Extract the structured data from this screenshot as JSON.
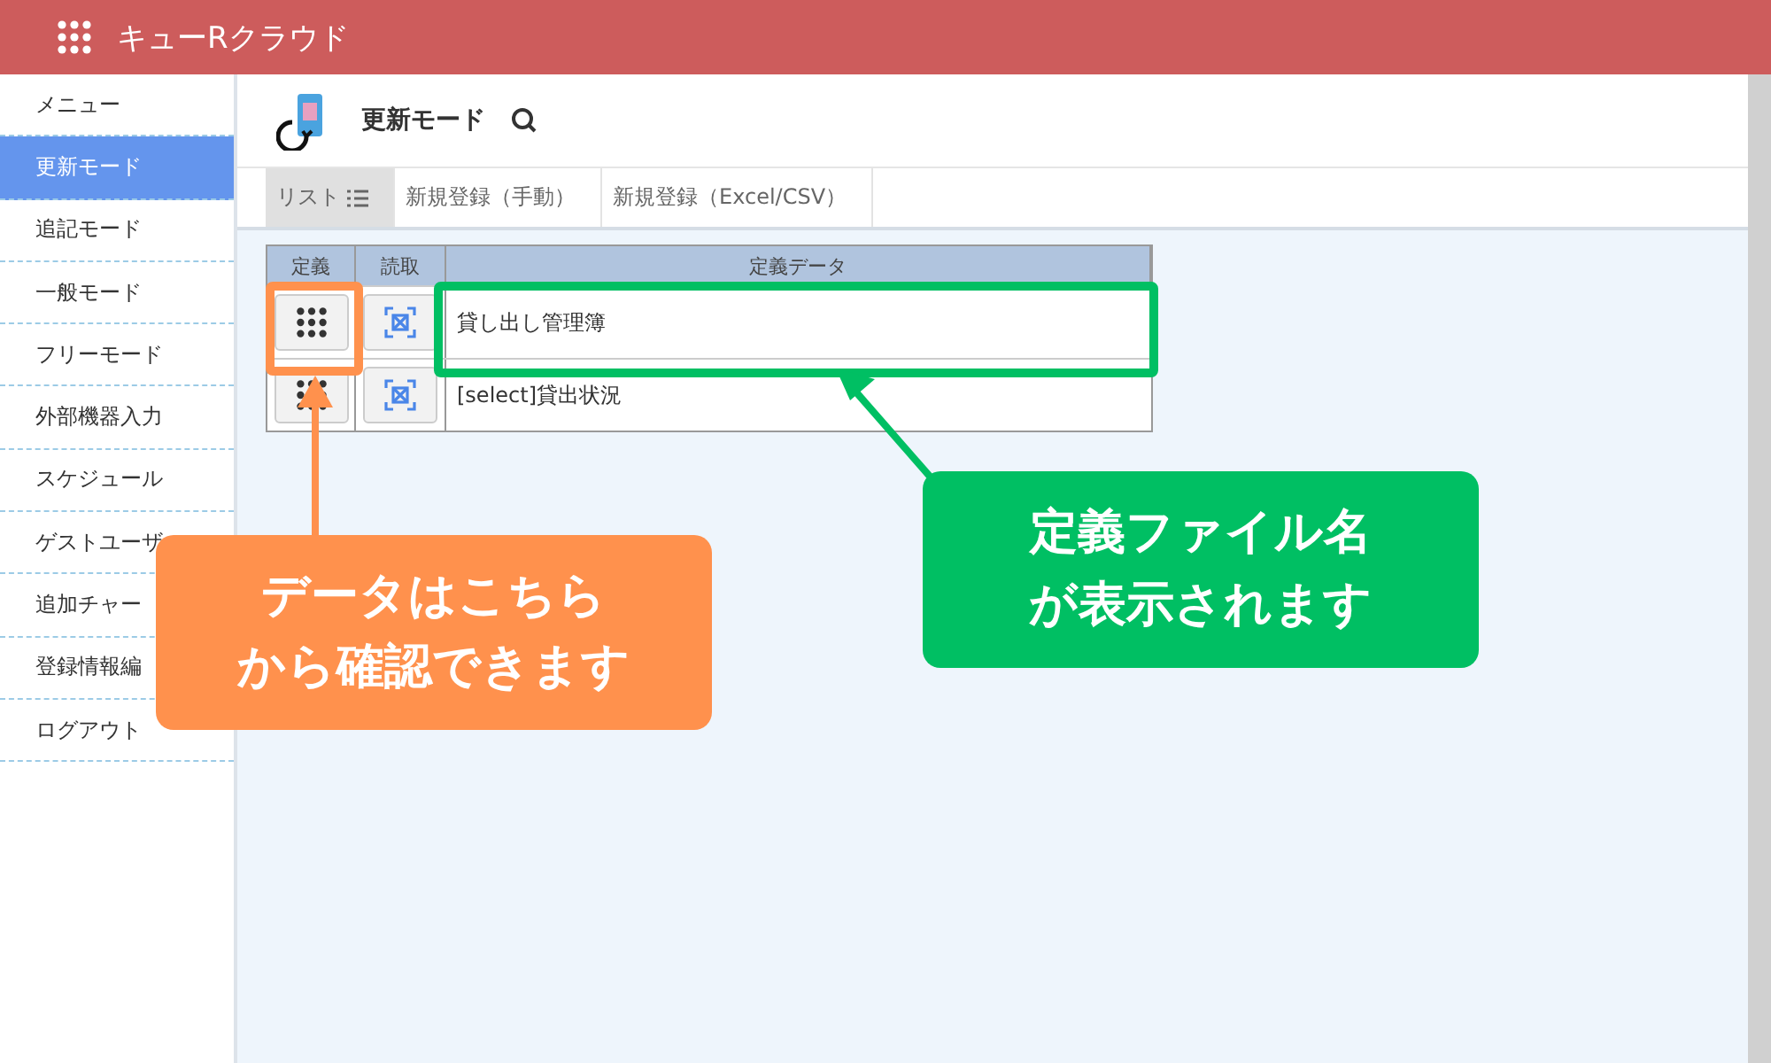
{
  "app": {
    "title": "キューRクラウド"
  },
  "sidebar": {
    "items": [
      {
        "label": "メニュー",
        "selected": false
      },
      {
        "label": "更新モード",
        "selected": true
      },
      {
        "label": "追記モード",
        "selected": false
      },
      {
        "label": "一般モード",
        "selected": false
      },
      {
        "label": "フリーモード",
        "selected": false
      },
      {
        "label": "外部機器入力",
        "selected": false
      },
      {
        "label": "スケジュール",
        "selected": false
      },
      {
        "label": "ゲストユーザ",
        "selected": false
      },
      {
        "label": "追加チャー",
        "selected": false
      },
      {
        "label": "登録情報編",
        "selected": false
      },
      {
        "label": "ログアウト",
        "selected": false
      }
    ]
  },
  "page": {
    "title": "更新モード"
  },
  "tabs": [
    {
      "label": "リスト",
      "selected": true
    },
    {
      "label": "新規登録（手動）",
      "selected": false
    },
    {
      "label": "新規登録（Excel/CSV）",
      "selected": false
    }
  ],
  "table": {
    "columns": [
      "定義",
      "読取",
      "定義データ"
    ],
    "rows": [
      {
        "name": "貸し出し管理簿"
      },
      {
        "name": "[select]貸出状況"
      }
    ]
  },
  "callouts": [
    {
      "lines": [
        "データはこちら",
        "から確認できます"
      ],
      "color": "#ff914d"
    },
    {
      "lines": [
        "定義ファイル名",
        "が表示されます"
      ],
      "color": "#00bf63"
    }
  ]
}
